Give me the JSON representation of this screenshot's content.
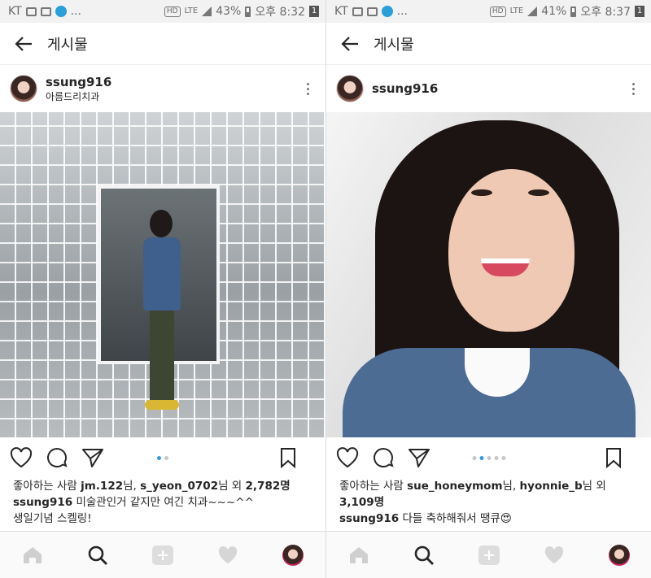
{
  "left": {
    "status": {
      "carrier": "KT",
      "network": "LTE",
      "battery": "43%",
      "time": "오후 8:32",
      "sim": "1",
      "hd": "HD",
      "dots": "..."
    },
    "header": {
      "title": "게시물"
    },
    "post": {
      "username": "ssung916",
      "location": "아름드리치과",
      "likes_prefix": "좋아하는 사람",
      "liker1": "jm.122",
      "liker_suffix1": "님,",
      "liker2": "s_yeon_0702",
      "liker_suffix2": "님 외",
      "like_count": "2,782명",
      "caption_user": "ssung916",
      "caption_line1": "미술관인거 같지만 여긴 치과~~~^^",
      "caption_line2": "생일기념 스켈링!"
    },
    "carousel": {
      "total": 2,
      "active": 1
    }
  },
  "right": {
    "status": {
      "carrier": "KT",
      "network": "LTE",
      "battery": "41%",
      "time": "오후 8:37",
      "sim": "1",
      "hd": "HD",
      "dots": "..."
    },
    "header": {
      "title": "게시물"
    },
    "post": {
      "username": "ssung916",
      "likes_prefix": "좋아하는 사람",
      "liker1": "sue_honeymom",
      "liker_suffix1": "님,",
      "liker2": "hyonnie_b",
      "liker_suffix2": "님 외",
      "like_count": "3,109명",
      "caption_user": "ssung916",
      "caption_line1": "다들 축하해줘서 땡큐😍"
    },
    "carousel": {
      "total": 5,
      "active": 2
    }
  },
  "colors": {
    "accent": "#2f9ee8",
    "text": "#262626"
  },
  "icons": [
    "back-arrow-icon",
    "more-icon",
    "heart-icon",
    "comment-icon",
    "share-icon",
    "bookmark-icon",
    "home-icon",
    "search-icon",
    "add-icon",
    "activity-icon",
    "profile-icon"
  ]
}
